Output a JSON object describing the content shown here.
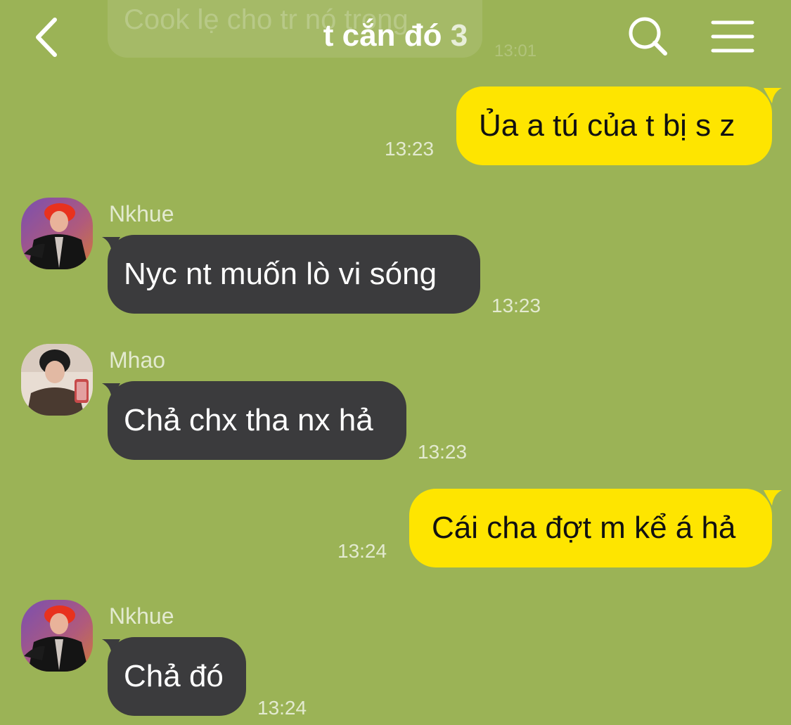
{
  "header": {
    "title": "t cắn đó",
    "member_count": "3",
    "back_icon": "chevron-left-icon",
    "search_icon": "search-icon",
    "menu_icon": "menu-icon"
  },
  "colors": {
    "background": "#9bb356",
    "outgoing_bubble": "#fee500",
    "incoming_bubble": "#3b3b3d"
  },
  "faded_message": {
    "text": "Cook lẹ cho tr nó trong",
    "time": "13:01"
  },
  "messages": [
    {
      "direction": "out",
      "text": "Ủa a tú của t bị s z",
      "time": "13:23"
    },
    {
      "direction": "in",
      "sender": "Nkhue",
      "text": "Nyc nt muốn lò vi sóng",
      "time": "13:23"
    },
    {
      "direction": "in",
      "sender": "Mhao",
      "text": "Chả chx tha nx hả",
      "time": "13:23"
    },
    {
      "direction": "out",
      "text": "Cái cha đợt m kể á hả",
      "time": "13:24"
    },
    {
      "direction": "in",
      "sender": "Nkhue",
      "text": "Chả đó",
      "time": "13:24"
    }
  ]
}
